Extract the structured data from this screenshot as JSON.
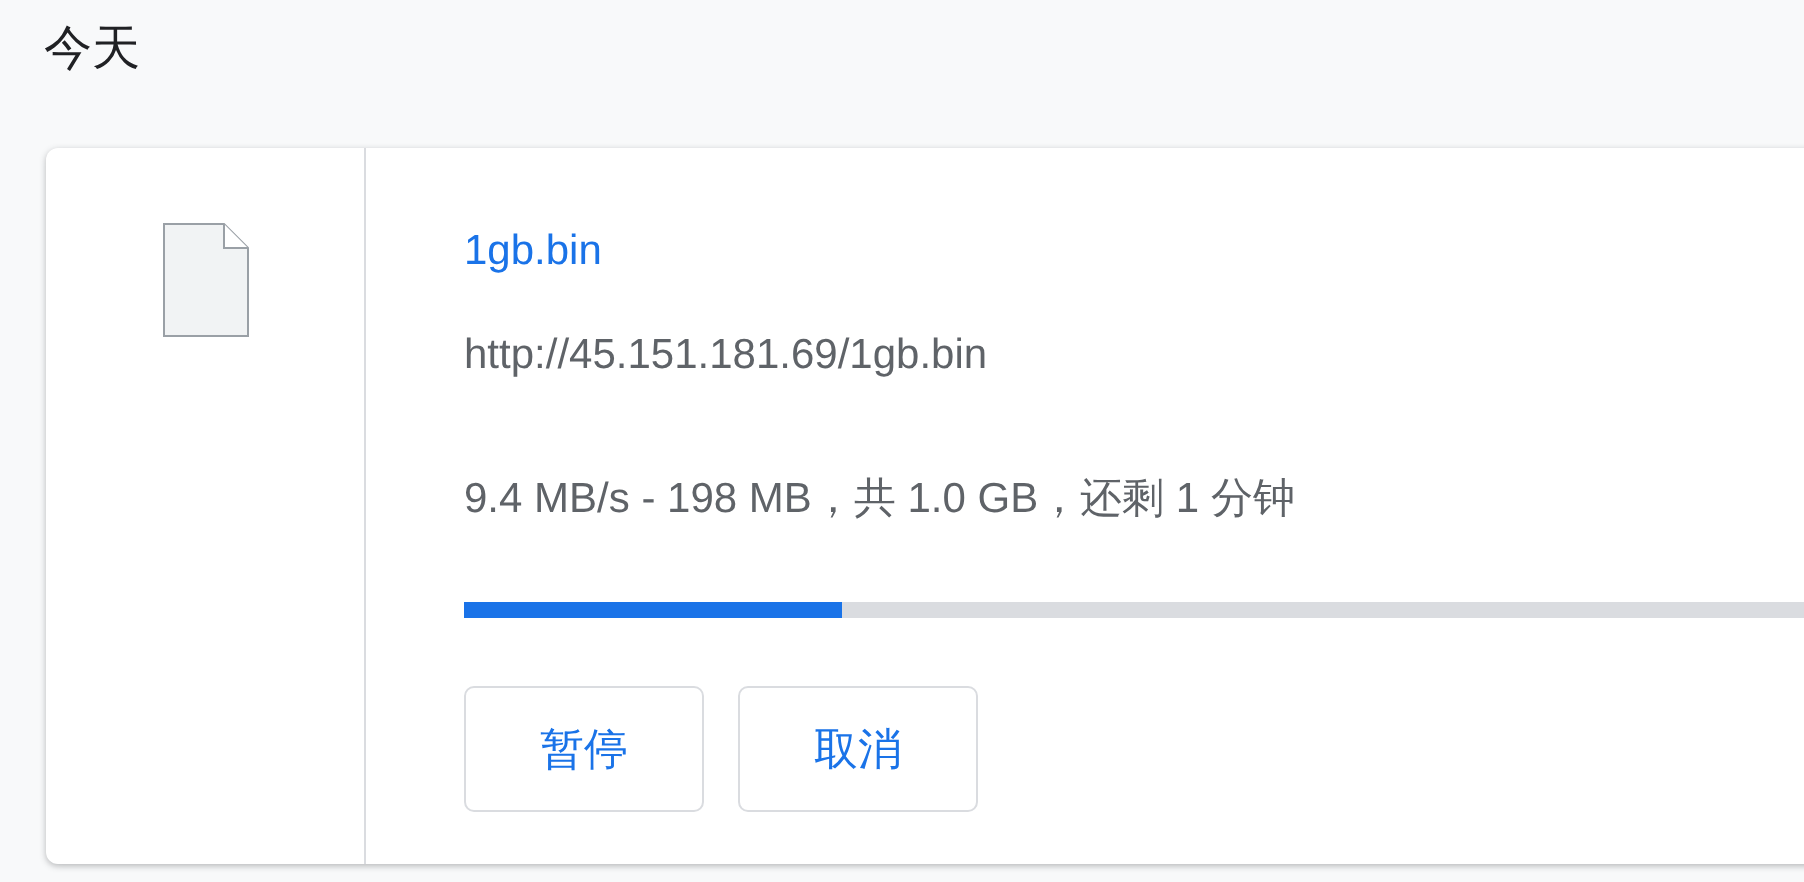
{
  "section_title": "今天",
  "download": {
    "file_name": "1gb.bin",
    "url": "http://45.151.181.69/1gb.bin",
    "status": "9.4 MB/s - 198 MB，共 1.0 GB，还剩 1 分钟",
    "level": 0.198,
    "buttons": [
      {
        "label": "暂停"
      },
      {
        "label": "取消"
      }
    ]
  }
}
